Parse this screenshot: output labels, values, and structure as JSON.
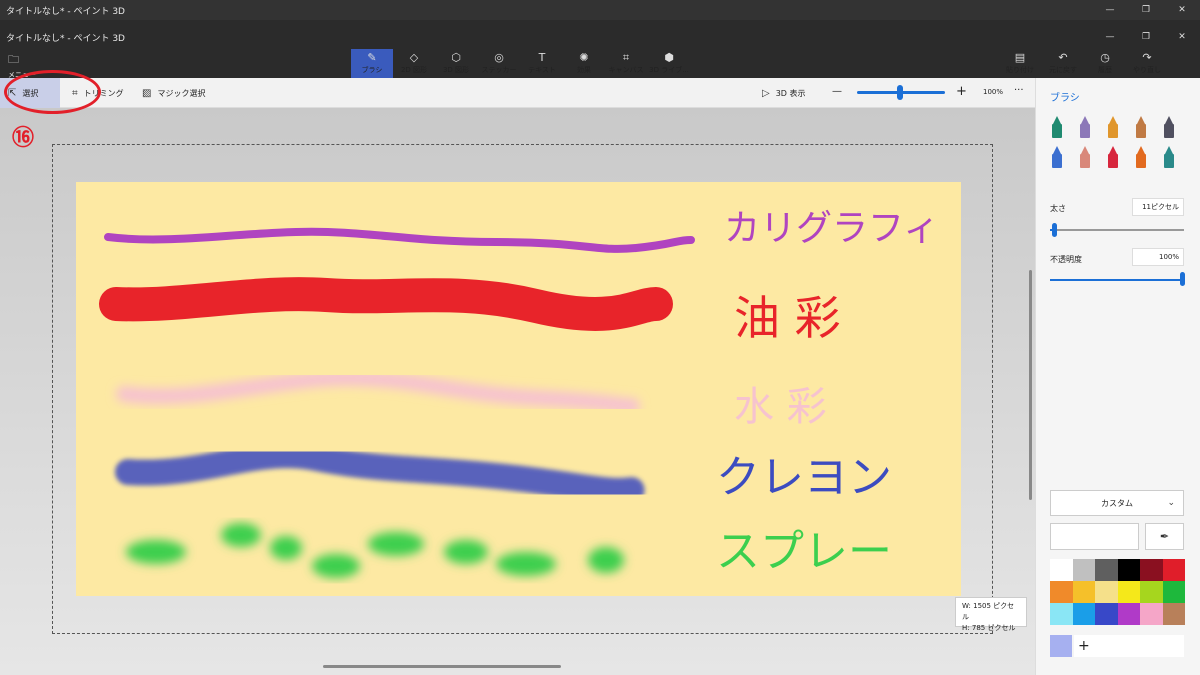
{
  "window": {
    "title_back": "タイトルなし* - ペイント 3D",
    "title_front": "タイトルなし* - ペイント 3D",
    "minimize": "—",
    "restore": "❐",
    "close": "✕"
  },
  "ribbon": {
    "menu_label": "メニュー",
    "tools": [
      {
        "label": "ブラシ",
        "icon": "brush-icon",
        "glyph": "✎"
      },
      {
        "label": "2D 図形",
        "icon": "2d-shapes-icon",
        "glyph": "◇"
      },
      {
        "label": "3D 図形",
        "icon": "3d-shapes-icon",
        "glyph": "⬡"
      },
      {
        "label": "ステッカー",
        "icon": "sticker-icon",
        "glyph": "◎"
      },
      {
        "label": "テキスト",
        "icon": "text-icon",
        "glyph": "T"
      },
      {
        "label": "効果",
        "icon": "effects-icon",
        "glyph": "✺"
      },
      {
        "label": "キャンバス",
        "icon": "canvas-icon",
        "glyph": "⌗"
      },
      {
        "label": "3D ライブ...",
        "icon": "3d-library-icon",
        "glyph": "⬢"
      }
    ],
    "right_actions": [
      {
        "label": "貼り付け",
        "icon": "paste-icon",
        "glyph": "▤"
      },
      {
        "label": "元に戻す",
        "icon": "undo-icon",
        "glyph": "↶"
      },
      {
        "label": "履歴",
        "icon": "history-icon",
        "glyph": "◷"
      },
      {
        "label": "やり直し",
        "icon": "redo-icon",
        "glyph": "↷"
      }
    ]
  },
  "toolbar": {
    "select_label": "選択",
    "crop_label": "トリミング",
    "magic_select_label": "マジック選択",
    "view3d_label": "3D 表示",
    "zoom_minus": "—",
    "zoom_plus": "+",
    "zoom_value": "100%",
    "more": "···",
    "zoom_level": 0.5
  },
  "annotation": {
    "number": "⑯",
    "color": "#e2202a"
  },
  "canvas": {
    "background": "#fde9a3",
    "size_w_label": "W:",
    "size_w": "1505 ピクセル",
    "size_h_label": "H:",
    "size_h": "785 ピクセル",
    "strokes": [
      {
        "name": "calligraphy",
        "color": "#b044c0",
        "label": "カリグラフィ"
      },
      {
        "name": "oil",
        "color": "#e8242a",
        "label": "油彩"
      },
      {
        "name": "watercolor",
        "color": "#f6c3cf",
        "label": "水彩"
      },
      {
        "name": "crayon",
        "color": "#3c4cc0",
        "label": "クレヨン"
      },
      {
        "name": "spray",
        "color": "#3ccf4e",
        "label": "スプレー"
      }
    ]
  },
  "panel": {
    "title": "ブラシ",
    "brushes": [
      {
        "name": "marker-icon",
        "color": "#1f8a70"
      },
      {
        "name": "calligraphy-pen-icon",
        "color": "#8c78b8"
      },
      {
        "name": "oil-brush-icon",
        "color": "#e0962c"
      },
      {
        "name": "watercolor-icon",
        "color": "#c07a44"
      },
      {
        "name": "pixel-pen-icon",
        "color": "#505060"
      },
      {
        "name": "pencil-icon",
        "color": "#3b6fd0"
      },
      {
        "name": "eraser-icon",
        "color": "#d9887a"
      },
      {
        "name": "crayon-icon",
        "color": "#d7263d"
      },
      {
        "name": "spray-can-icon",
        "color": "#e26a1f"
      },
      {
        "name": "fill-icon",
        "color": "#2a8a8a"
      }
    ],
    "thickness_label": "太さ",
    "thickness_value": "11ピクセル",
    "thickness_level": 0.03,
    "opacity_label": "不透明度",
    "opacity_value": "100%",
    "opacity_level": 1.0,
    "color_mode": "カスタム",
    "palette": [
      "#ffffff",
      "#c0c0c0",
      "#5f5f5f",
      "#000000",
      "#8a1020",
      "#e01e2a",
      "#f08a2a",
      "#f5c02a",
      "#f5e08a",
      "#f5e81a",
      "#a6d61e",
      "#1eb83c",
      "#8ae6f5",
      "#1a9ee8",
      "#3848c8",
      "#b03ac8",
      "#f5a6c8",
      "#b8805a"
    ],
    "current_color": "#a6b0f0",
    "add_label": "+"
  }
}
